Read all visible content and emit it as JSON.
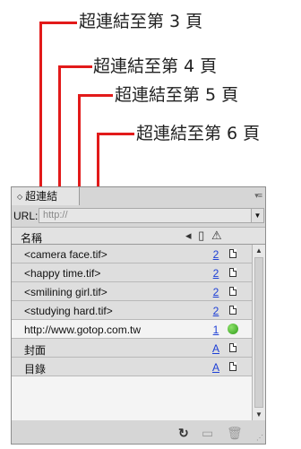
{
  "callouts": [
    {
      "label": "超連結至第 3 頁"
    },
    {
      "label": "超連結至第 4 頁"
    },
    {
      "label": "超連結至第 5 頁"
    },
    {
      "label": "超連結至第 6 頁"
    }
  ],
  "panel": {
    "tab_arrows": "◇",
    "title": "超連結",
    "menu_icon": "▾≡",
    "url_label": "URL:",
    "url_placeholder": "http://",
    "url_dropdown_icon": "▼",
    "column_name": "名稱",
    "header_icons": [
      "sort-icon",
      "page-icon",
      "warning-icon"
    ],
    "rows": [
      {
        "name": "<camera face.tif>",
        "page": "2",
        "icon": "page-icon",
        "shade": "dark"
      },
      {
        "name": "<happy time.tif>",
        "page": "2",
        "icon": "page-icon",
        "shade": "dark"
      },
      {
        "name": "<smilining girl.tif>",
        "page": "2",
        "icon": "page-icon",
        "shade": "dark"
      },
      {
        "name": "<studying hard.tif>",
        "page": "2",
        "icon": "page-icon",
        "shade": "dark"
      },
      {
        "name": "http://www.gotop.com.tw",
        "page": "1",
        "icon": "status-ok-icon",
        "shade": "light"
      },
      {
        "name": "封面",
        "page": "A",
        "icon": "page-icon",
        "shade": "dark"
      },
      {
        "name": "目錄",
        "page": "A",
        "icon": "page-icon",
        "shade": "dark"
      }
    ],
    "bottom_icons": [
      "refresh-icon",
      "goto-page-icon",
      "delete-icon"
    ],
    "colors": {
      "callout_line": "#e21a1a",
      "link_blue": "#1d3fd6",
      "status_green": "#3aa821"
    }
  }
}
